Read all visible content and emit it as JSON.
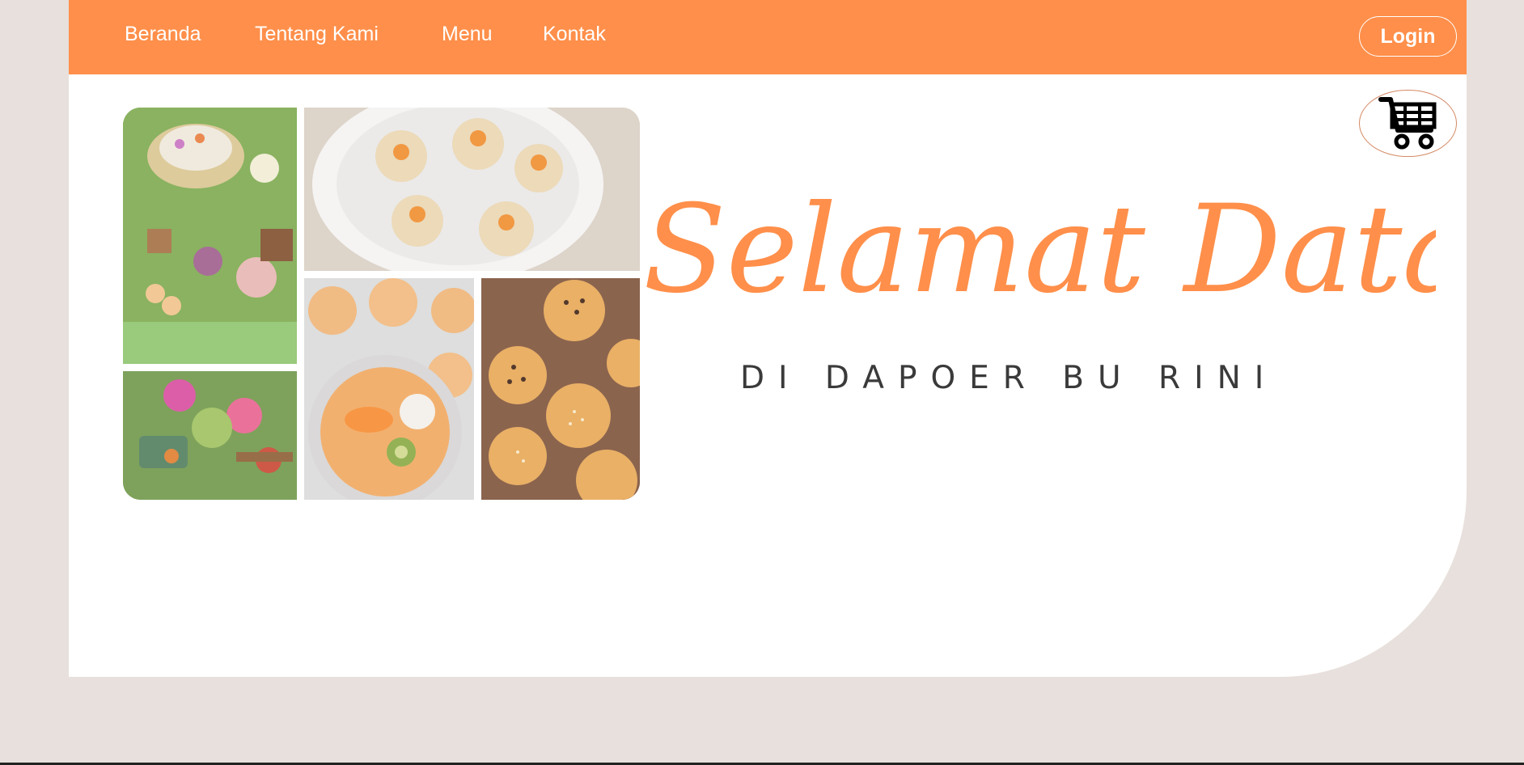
{
  "nav": {
    "items": [
      {
        "label": "Beranda"
      },
      {
        "label": "Tentang Kami"
      },
      {
        "label": "Menu"
      },
      {
        "label": "Kontak"
      }
    ],
    "login_label": "Login",
    "cart_icon": "shopping-cart-icon"
  },
  "hero": {
    "title": "Selamat Datang",
    "subtitle": "DI DAPOER BU RINI"
  },
  "colors": {
    "brand": "#ff8f4a",
    "background": "#e8e0dc",
    "page": "#ffffff"
  }
}
